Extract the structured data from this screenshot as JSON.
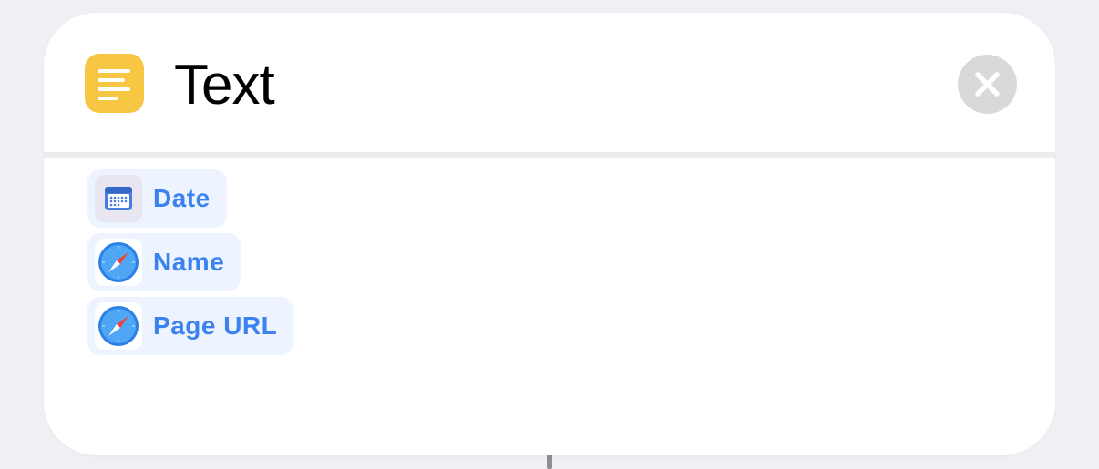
{
  "action": {
    "title": "Text",
    "icon": "text-lines-icon",
    "accent_color": "#f7c744",
    "close_icon": "close-icon"
  },
  "tokens": [
    {
      "label": "Date",
      "icon": "calendar-icon"
    },
    {
      "label": "Name",
      "icon": "safari-compass-icon"
    },
    {
      "label": "Page URL",
      "icon": "safari-compass-icon"
    }
  ],
  "colors": {
    "token_text": "#3a82f0",
    "token_background": "#eef4ff",
    "close_button": "#d9d9dc"
  }
}
